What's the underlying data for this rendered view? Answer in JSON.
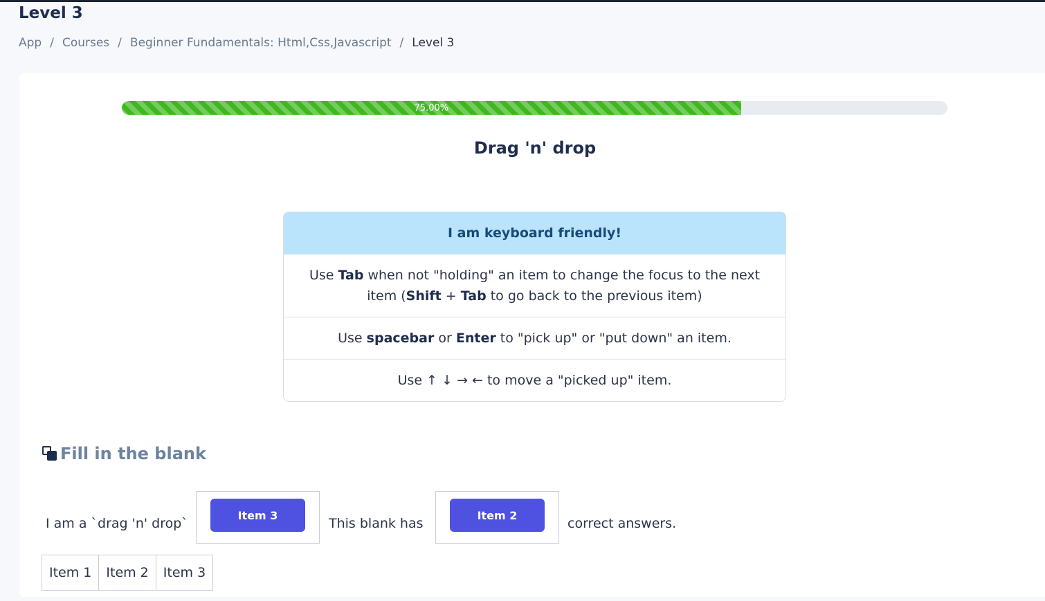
{
  "page": {
    "title": "Level 3",
    "breadcrumb": [
      "App",
      "Courses",
      "Beginner Fundamentals: Html,Css,Javascript",
      "Level 3"
    ],
    "breadcrumb_separator": "/"
  },
  "progress": {
    "value_percent": 75.0,
    "label": "75.00%",
    "fill_color": "#3fb81f"
  },
  "activity": {
    "title": "Drag 'n' drop",
    "keyboard_help": {
      "header": "I am keyboard friendly!",
      "row1": {
        "t1": "Use ",
        "b1": "Tab",
        "t2": " when not \"holding\" an item to change the focus to the next item (",
        "b2": "Shift",
        "t3": " + ",
        "b3": "Tab",
        "t4": " to go back to the previous item)"
      },
      "row2": {
        "t1": "Use ",
        "b1": "spacebar",
        "t2": " or ",
        "b2": "Enter",
        "t3": " to \"pick up\" or \"put down\" an item."
      },
      "row3": {
        "t1": "Use ↑ ↓ → ← to move a \"picked up\" item."
      }
    }
  },
  "fill_blank": {
    "heading": "Fill in the blank",
    "icon": "copy-icon",
    "text1": "I am a `drag 'n' drop`",
    "blank1": "Item 3",
    "text2": "This blank has",
    "blank2": "Item 2",
    "text3": "correct answers.",
    "bank": [
      "Item 1",
      "Item 2",
      "Item 3"
    ]
  },
  "colors": {
    "accent": "#4f52e0",
    "header_bg": "#b9e4fb"
  }
}
